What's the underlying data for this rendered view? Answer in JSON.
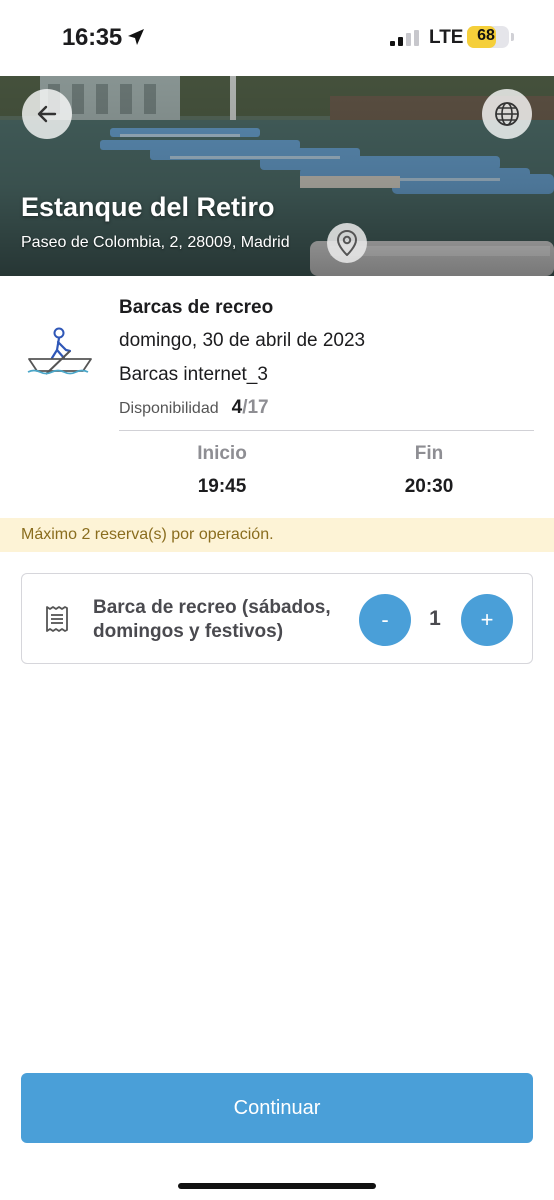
{
  "status_bar": {
    "time": "16:35",
    "network": "LTE",
    "battery": "68",
    "battery_level": 0.68
  },
  "header": {
    "title": "Estanque del Retiro",
    "address": "Paseo de Colombia, 2, 28009, Madrid",
    "back_icon": "arrow-left-icon",
    "language_icon": "globe-icon",
    "location_icon": "map-pin-icon"
  },
  "activity": {
    "icon": "rowing-boat-icon",
    "name": "Barcas de recreo",
    "date": "domingo, 30 de abril de 2023",
    "session": "Barcas internet_3",
    "availability_label": "Disponibilidad",
    "availability_now": "4",
    "availability_total": "/17",
    "start_label": "Inicio",
    "start_time": "19:45",
    "end_label": "Fin",
    "end_time": "20:30"
  },
  "notice": "Máximo 2 reserva(s) por operación.",
  "ticket": {
    "icon": "receipt-icon",
    "name": "Barca de recreo (sábados, domingos y festivos)",
    "decrement_label": "-",
    "quantity": "1",
    "increment_label": "+"
  },
  "continue_label": "Continuar",
  "colors": {
    "primary": "#4a9fd8",
    "notice_bg": "#fdf3d6",
    "notice_text": "#8a6d1e",
    "battery": "#f5cf3a"
  }
}
